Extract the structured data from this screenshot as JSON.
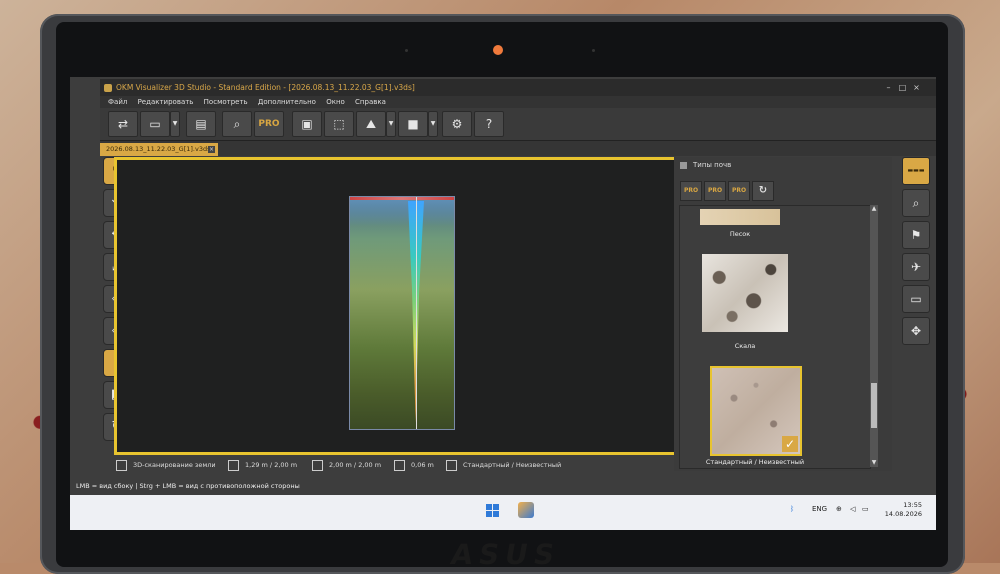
{
  "window": {
    "title": "OKM Visualizer 3D Studio - Standard Edition - [2026.08.13_11.22.03_G[1].v3ds]",
    "controls": [
      "–",
      "□",
      "×"
    ]
  },
  "menu": [
    "Файл",
    "Редактировать",
    "Посмотреть",
    "Дополнительно",
    "Окно",
    "Справка"
  ],
  "toolbar": {
    "buttons": [
      {
        "icon": "import-icon",
        "glyph": "⇄"
      },
      {
        "icon": "open-folder-icon",
        "glyph": "▭"
      },
      {
        "icon": "save-icon",
        "glyph": "▤"
      },
      {
        "icon": "report-search-icon",
        "glyph": "⌕"
      },
      {
        "icon": "pro-icon",
        "glyph": "PRO"
      },
      {
        "icon": "screenshot-icon",
        "glyph": "▣"
      },
      {
        "icon": "cube-select-icon",
        "glyph": "⬚"
      },
      {
        "icon": "terrain-icon",
        "glyph": "⛰"
      },
      {
        "icon": "color-icon",
        "glyph": "■"
      },
      {
        "icon": "settings-icon",
        "glyph": "⚙"
      },
      {
        "icon": "help-icon",
        "glyph": "?"
      }
    ]
  },
  "tab": {
    "label": "2026.08.13_11.22.03_G[1].v3ds",
    "close": "×"
  },
  "left_tools": [
    {
      "icon": "pointer-icon",
      "glyph": "↖",
      "active": true
    },
    {
      "icon": "rotate-icon",
      "glyph": "⟲",
      "active": false
    },
    {
      "icon": "move-icon",
      "glyph": "✥",
      "active": false
    },
    {
      "icon": "zoom-icon",
      "glyph": "⤢",
      "active": false
    },
    {
      "icon": "cube-view-icon",
      "glyph": "◈",
      "active": false
    },
    {
      "icon": "cube-top-icon",
      "glyph": "◇",
      "active": false
    },
    {
      "icon": "side-view-icon",
      "glyph": "▮",
      "active": true
    },
    {
      "icon": "cube-corner-icon",
      "glyph": "◩",
      "active": false
    },
    {
      "icon": "reset-view-icon",
      "glyph": "↻",
      "active": false
    }
  ],
  "status": {
    "mode": "3D-сканирование земли",
    "size1": "1,29 m / 2,00 m",
    "size2": "2,00 m / 2,00 m",
    "depth": "0,06 m",
    "soil": "Стандартный / Неизвестный"
  },
  "hint": "LMB = вид сбоку | Strg + LMB = вид с противоположной стороны",
  "soil_panel": {
    "title": "Типы почв",
    "buttons": [
      "PRO",
      "PRO",
      "PRO",
      "↻"
    ],
    "items": [
      {
        "label": "Песок",
        "selected": false
      },
      {
        "label": "Скала",
        "selected": false
      },
      {
        "label": "Стандартный / Неизвестный",
        "selected": true
      }
    ]
  },
  "right_tools": [
    {
      "icon": "panel-label-icon",
      "glyph": "▬▬▬",
      "active": true
    },
    {
      "icon": "scan-search-icon",
      "glyph": "⌕",
      "active": false
    },
    {
      "icon": "bookmark-icon",
      "glyph": "⚑",
      "active": false
    },
    {
      "icon": "satellite-icon",
      "glyph": "✈",
      "active": false
    },
    {
      "icon": "monitor-settings-icon",
      "glyph": "▭",
      "active": false
    },
    {
      "icon": "navigation-icon",
      "glyph": "✥",
      "active": false
    }
  ],
  "taskbar": {
    "lang": "ENG",
    "time": "13:55",
    "date": "14.08.2026"
  },
  "device_logo": "ASUS"
}
